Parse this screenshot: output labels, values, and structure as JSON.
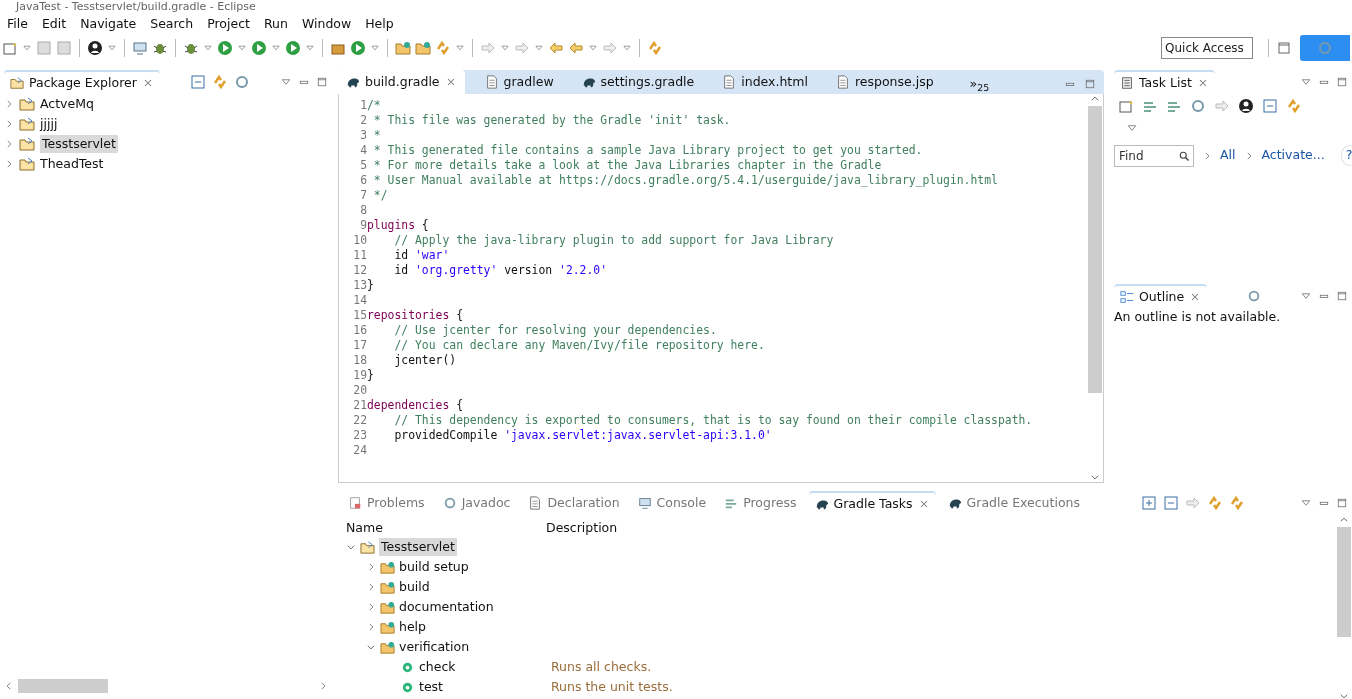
{
  "window": {
    "title": "JavaTest - Tesstservlet/build.gradle - Eclipse"
  },
  "menu": [
    "File",
    "Edit",
    "Navigate",
    "Search",
    "Project",
    "Run",
    "Window",
    "Help"
  ],
  "quick_access": {
    "placeholder": "Quick Access"
  },
  "package_explorer": {
    "title": "Package Explorer",
    "items": [
      {
        "label": "ActveMq",
        "expanded": false,
        "selected": false
      },
      {
        "label": "jjjjj",
        "expanded": false,
        "selected": false
      },
      {
        "label": "Tesstservlet",
        "expanded": false,
        "selected": true
      },
      {
        "label": "TheadTest",
        "expanded": false,
        "selected": false
      }
    ]
  },
  "editor": {
    "tabs": [
      {
        "label": "build.gradle",
        "kind": "gradle",
        "selected": true
      },
      {
        "label": "gradlew",
        "kind": "file",
        "selected": false
      },
      {
        "label": "settings.gradle",
        "kind": "gradle",
        "selected": false
      },
      {
        "label": "index.html",
        "kind": "file",
        "selected": false
      },
      {
        "label": "response.jsp",
        "kind": "file",
        "selected": false
      }
    ],
    "overflow": "»",
    "overflow_count": "25",
    "lines": [
      {
        "number": "1",
        "segments": [
          {
            "kind": "comment",
            "text": "/*"
          }
        ]
      },
      {
        "number": "2",
        "segments": [
          {
            "kind": "comment",
            "text": " * This file was generated by the Gradle 'init' task."
          }
        ]
      },
      {
        "number": "3",
        "segments": [
          {
            "kind": "comment",
            "text": " *"
          }
        ]
      },
      {
        "number": "4",
        "segments": [
          {
            "kind": "comment",
            "text": " * This generated file contains a sample Java Library project to get you started."
          }
        ]
      },
      {
        "number": "5",
        "segments": [
          {
            "kind": "comment",
            "text": " * For more details take a look at the Java Libraries chapter in the Gradle"
          }
        ]
      },
      {
        "number": "6",
        "segments": [
          {
            "kind": "comment",
            "text": " * User Manual available at https://docs.gradle.org/5.4.1/userguide/java_library_plugin.html"
          }
        ]
      },
      {
        "number": "7",
        "segments": [
          {
            "kind": "comment",
            "text": " */"
          }
        ]
      },
      {
        "number": "8"
      },
      {
        "number": "9",
        "segments": [
          {
            "kind": "keyword",
            "text": "plugins"
          },
          {
            "kind": "plain",
            "text": " {"
          }
        ]
      },
      {
        "number": "10",
        "segments": [
          {
            "kind": "comment",
            "text": "    // Apply the java-library plugin to add support for Java Library"
          }
        ]
      },
      {
        "number": "11",
        "segments": [
          {
            "kind": "plain",
            "text": "    id "
          },
          {
            "kind": "string",
            "text": "'war'"
          }
        ]
      },
      {
        "number": "12",
        "segments": [
          {
            "kind": "plain",
            "text": "    id "
          },
          {
            "kind": "string",
            "text": "'org.gretty'"
          },
          {
            "kind": "plain",
            "text": " version "
          },
          {
            "kind": "string",
            "text": "'2.2.0'"
          }
        ]
      },
      {
        "number": "13",
        "segments": [
          {
            "kind": "plain",
            "text": "}"
          }
        ]
      },
      {
        "number": "14"
      },
      {
        "number": "15",
        "segments": [
          {
            "kind": "keyword",
            "text": "repositories"
          },
          {
            "kind": "plain",
            "text": " {"
          }
        ]
      },
      {
        "number": "16",
        "segments": [
          {
            "kind": "comment",
            "text": "    // Use jcenter for resolving your dependencies."
          }
        ]
      },
      {
        "number": "17",
        "segments": [
          {
            "kind": "comment",
            "text": "    // You can declare any Maven/Ivy/file repository here."
          }
        ]
      },
      {
        "number": "18",
        "segments": [
          {
            "kind": "plain",
            "text": "    jcenter()"
          }
        ]
      },
      {
        "number": "19",
        "segments": [
          {
            "kind": "plain",
            "text": "}"
          }
        ]
      },
      {
        "number": "20"
      },
      {
        "number": "21",
        "segments": [
          {
            "kind": "keyword",
            "text": "dependencies"
          },
          {
            "kind": "plain",
            "text": " {"
          }
        ]
      },
      {
        "number": "22",
        "segments": [
          {
            "kind": "comment",
            "text": "    // This dependency is exported to consumers, that is to say found on their compile classpath."
          }
        ]
      },
      {
        "number": "23",
        "segments": [
          {
            "kind": "plain",
            "text": "    providedCompile "
          },
          {
            "kind": "string",
            "text": "'javax.servlet:javax.servlet-api:3.1.0'"
          }
        ]
      },
      {
        "number": "24"
      }
    ]
  },
  "task_list": {
    "title": "Task List",
    "find": {
      "placeholder": "Find"
    },
    "links": [
      "All",
      "Activate..."
    ],
    "help": "?"
  },
  "outline": {
    "title": "Outline",
    "message": "An outline is not available."
  },
  "bottom": {
    "tabs": [
      {
        "label": "Problems",
        "kind": "problems",
        "selected": false
      },
      {
        "label": "Javadoc",
        "kind": "javadoc",
        "selected": false
      },
      {
        "label": "Declaration",
        "kind": "declaration",
        "selected": false
      },
      {
        "label": "Console",
        "kind": "console",
        "selected": false
      },
      {
        "label": "Progress",
        "kind": "progress",
        "selected": false
      },
      {
        "label": "Gradle Tasks",
        "kind": "gradle",
        "selected": true
      },
      {
        "label": "Gradle Executions",
        "kind": "gradle",
        "selected": false
      }
    ],
    "columns": [
      "Name",
      "Description"
    ],
    "tree": [
      {
        "label": "Tesstservlet",
        "kind": "project",
        "expanded": true,
        "selected": true,
        "children": [
          {
            "label": "build setup",
            "kind": "group",
            "expanded": false,
            "selected": false
          },
          {
            "label": "build",
            "kind": "group",
            "expanded": false,
            "selected": false
          },
          {
            "label": "documentation",
            "kind": "group",
            "expanded": false,
            "selected": false
          },
          {
            "label": "help",
            "kind": "group",
            "expanded": false,
            "selected": false
          },
          {
            "label": "verification",
            "kind": "group",
            "expanded": true,
            "selected": false,
            "children": [
              {
                "label": "check",
                "kind": "task",
                "description": "Runs all checks.",
                "selected": false
              },
              {
                "label": "test",
                "kind": "task",
                "description": "Runs the unit tests.",
                "selected": false
              }
            ]
          }
        ]
      }
    ]
  }
}
